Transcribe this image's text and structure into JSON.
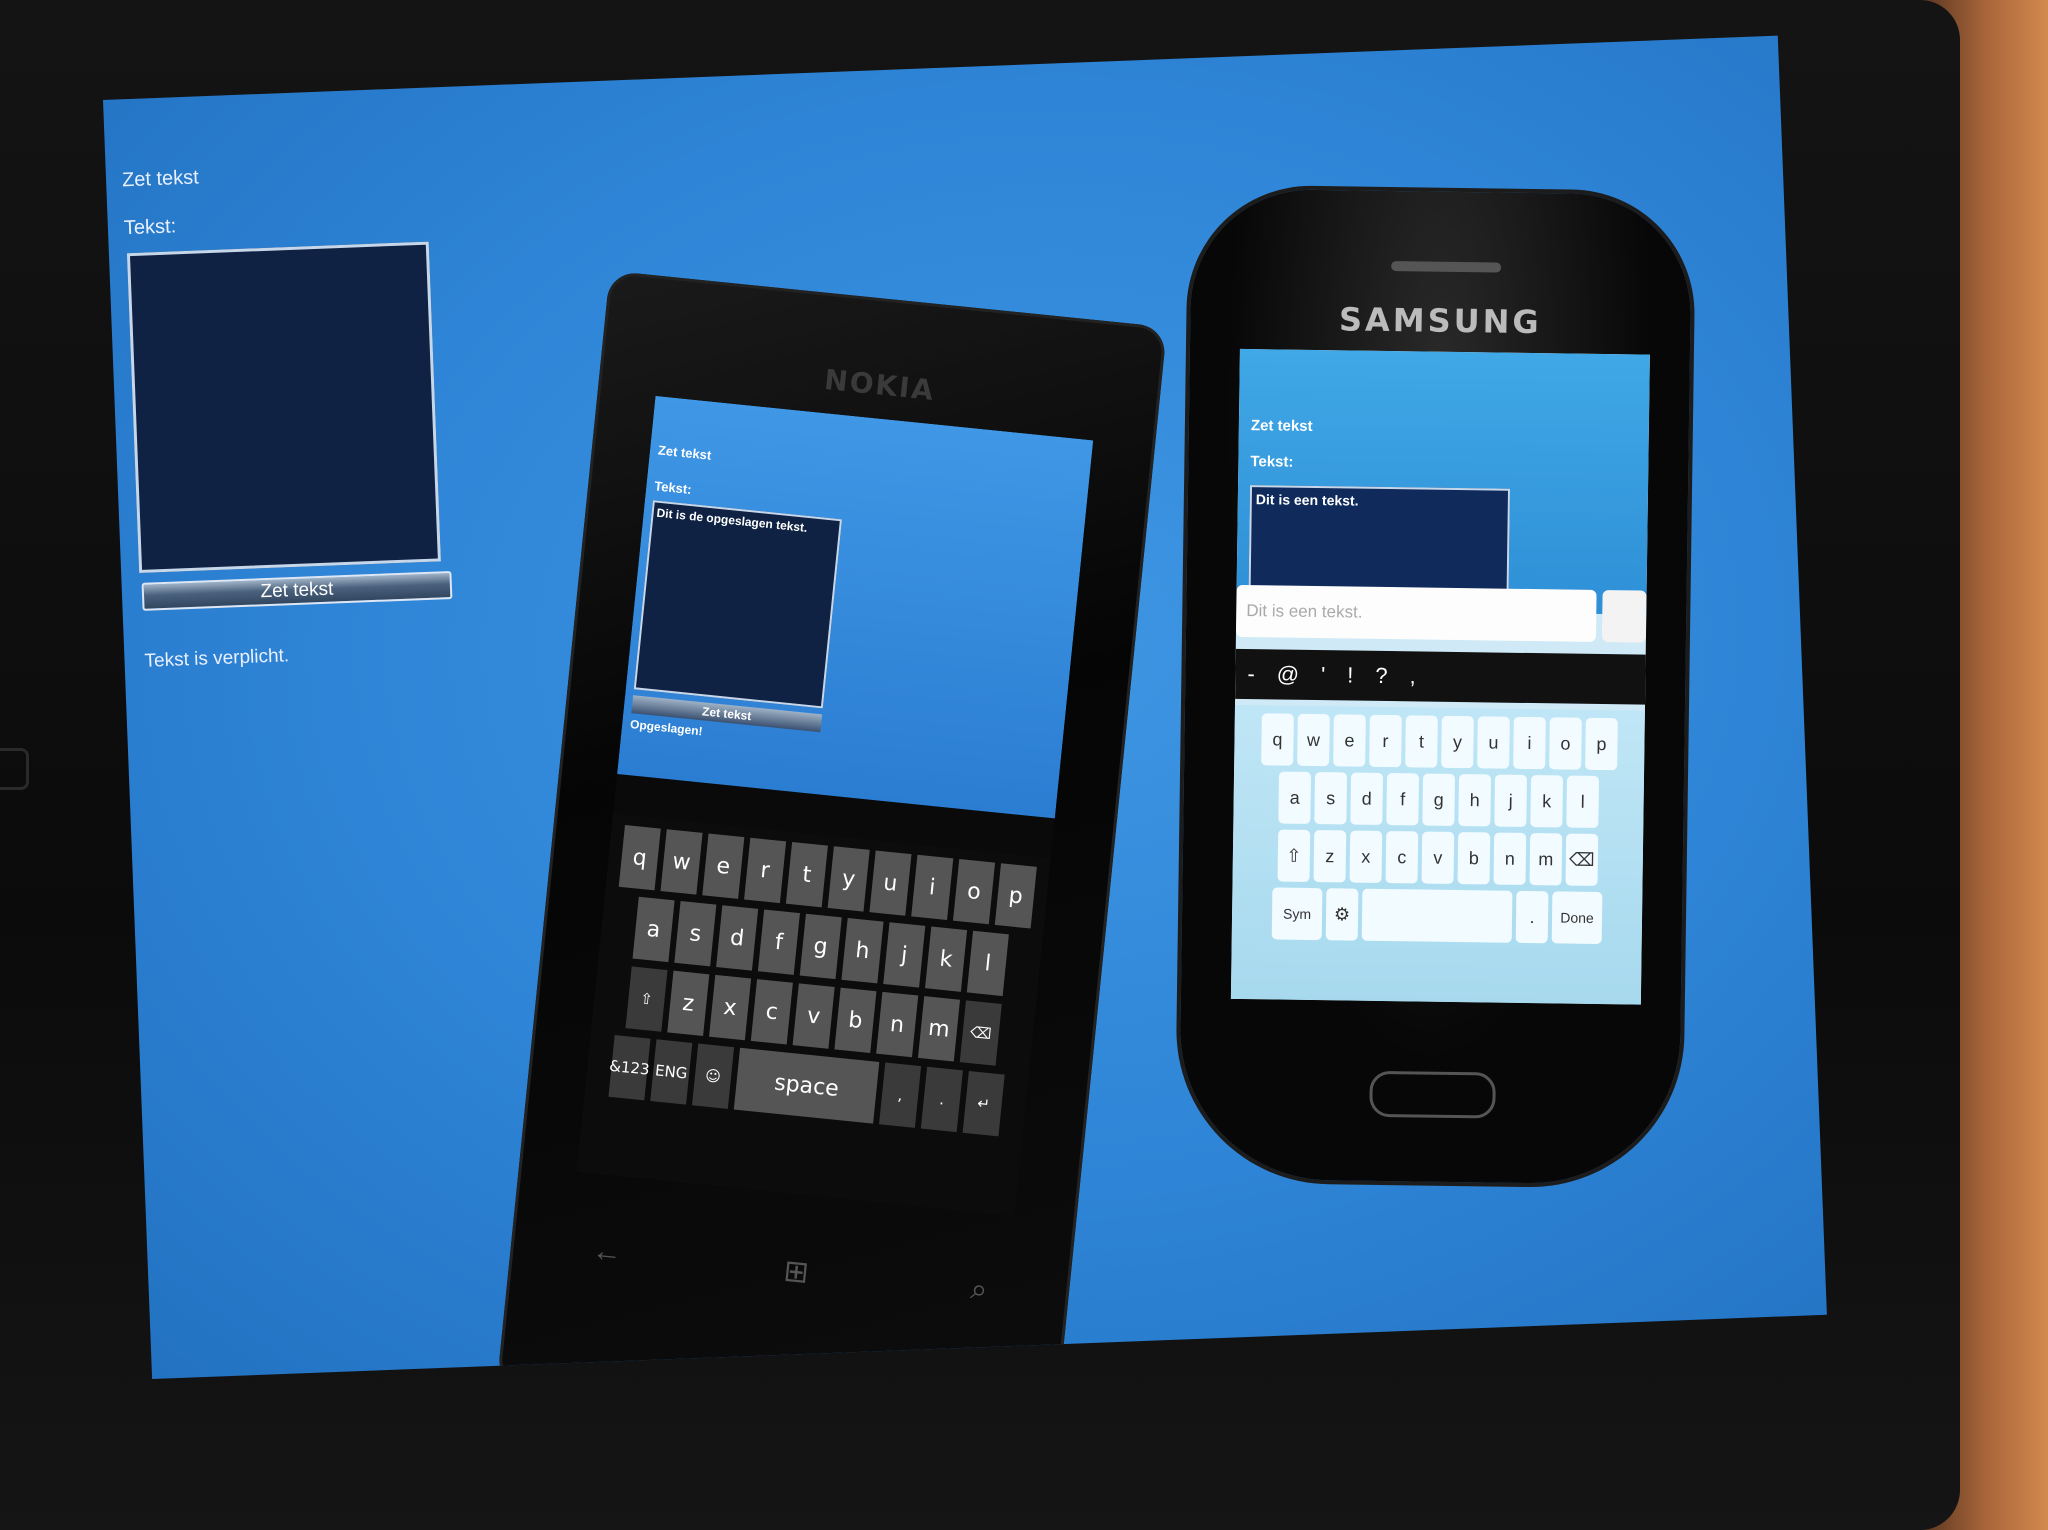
{
  "tablet_app": {
    "title": "Zet tekst",
    "label": "Tekst:",
    "textbox_value": "",
    "button_label": "Zet tekst",
    "status": "Tekst is verplicht."
  },
  "nokia": {
    "brand": "NOKIA",
    "app": {
      "title": "Zet tekst",
      "label": "Tekst:",
      "textbox_value": "Dit is de opgeslagen tekst.",
      "button_label": "Zet tekst",
      "status": "Opgeslagen!"
    },
    "keyboard": {
      "row1": [
        "q",
        "w",
        "e",
        "r",
        "t",
        "y",
        "u",
        "i",
        "o",
        "p"
      ],
      "row2": [
        "a",
        "s",
        "d",
        "f",
        "g",
        "h",
        "j",
        "k",
        "l"
      ],
      "row3": [
        "⇧",
        "z",
        "x",
        "c",
        "v",
        "b",
        "n",
        "m",
        "⌫"
      ],
      "row4_left": [
        "&123",
        "ENG",
        "☺"
      ],
      "space": "space",
      "row4_right": [
        ",",
        ".",
        "↵"
      ]
    }
  },
  "samsung": {
    "brand": "SAMSUNG",
    "app": {
      "title": "Zet tekst",
      "label": "Tekst:",
      "textbox_value": "Dit is een tekst.",
      "input_placeholder": "Dit is een tekst."
    },
    "suggestion_bar": [
      "-",
      "@",
      "'",
      "!",
      "?",
      ","
    ],
    "keyboard": {
      "row1": [
        "q",
        "w",
        "e",
        "r",
        "t",
        "y",
        "u",
        "i",
        "o",
        "p"
      ],
      "row2": [
        "a",
        "s",
        "d",
        "f",
        "g",
        "h",
        "j",
        "k",
        "l"
      ],
      "row3": [
        "⇧",
        "z",
        "x",
        "c",
        "v",
        "b",
        "n",
        "m",
        "⌫"
      ],
      "sym": "Sym",
      "gear": "⚙",
      "dot": ".",
      "done": "Done"
    }
  }
}
